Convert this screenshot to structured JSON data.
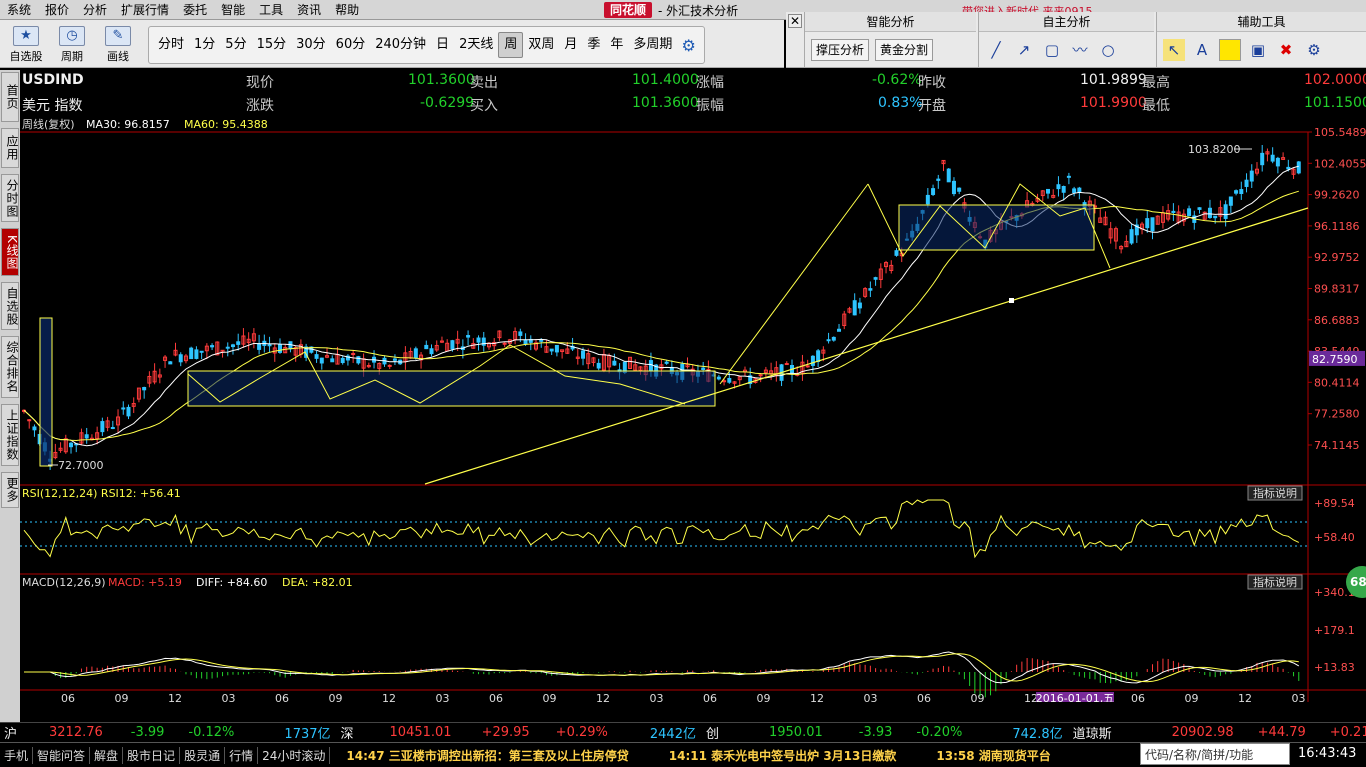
{
  "menu": {
    "items": [
      "系统",
      "报价",
      "分析",
      "扩展行情",
      "委托",
      "智能",
      "工具",
      "资讯",
      "帮助"
    ],
    "brand": "同花顺",
    "app_title": "- 外汇技术分析",
    "news": "带您进入新时代  来来0915"
  },
  "toolbar": {
    "favorites_label": "自选股",
    "cycle_label": "周期",
    "draw_label": "画线",
    "periods": [
      "分时",
      "1分",
      "5分",
      "15分",
      "30分",
      "60分",
      "240分钟",
      "日",
      "2天线",
      "周",
      "双周",
      "月",
      "季",
      "年",
      "多周期"
    ],
    "active_period": "周"
  },
  "right_tools": {
    "smart_title": "智能分析",
    "smart_buttons": [
      "撑压分析",
      "黄金分割"
    ],
    "self_title": "自主分析",
    "aux_title": "辅助工具"
  },
  "left_tabs": [
    "首页",
    "应用",
    "分时图",
    "K线图",
    "自选股",
    "综合排名",
    "上证指数",
    "更多"
  ],
  "quote": {
    "symbol": "USDIND",
    "name": "美元 指数",
    "price_label": "现价",
    "price": "101.3600",
    "change_label": "涨跌",
    "change": "-0.6299",
    "sell_label": "卖出",
    "sell": "101.4000",
    "buy_label": "买入",
    "buy": "101.3600",
    "pct_label": "涨幅",
    "pct": "-0.62%",
    "amp_label": "振幅",
    "amp": "0.83%",
    "prev_label": "昨收",
    "prev": "101.9899",
    "open_label": "开盘",
    "open": "101.9900",
    "high_label": "最高",
    "high": "102.0000",
    "low_label": "最低",
    "low": "101.1500"
  },
  "chart_data": {
    "type": "line",
    "main_header": {
      "period": "周线(复权)",
      "ma30": "MA30: 96.8157",
      "ma60": "MA60: 95.4388"
    },
    "price_axis": [
      "105.5489",
      "102.4055",
      "99.2620",
      "96.1186",
      "92.9752",
      "89.8317",
      "86.6883",
      "83.5449",
      "80.4114",
      "77.2580",
      "74.1145"
    ],
    "current_price_tag": "82.7590",
    "annotations": [
      "103.8200",
      "72.7000"
    ],
    "rsi_header": "RSI(12,12,24)  RSI12: +56.41",
    "rsi_axis": [
      "+89.54",
      "+58.40"
    ],
    "macd_header": {
      "name": "MACD(12,26,9)",
      "macd": "MACD: +5.19",
      "diff": "DIFF: +84.60",
      "dea": "DEA: +82.01"
    },
    "macd_axis": [
      "+340.1",
      "+179.1",
      "+13.83"
    ],
    "indicator_button": "指标说明",
    "x_ticks": [
      "06",
      "09",
      "12",
      "03",
      "06",
      "09",
      "12",
      "03",
      "06",
      "09",
      "12",
      "03",
      "06",
      "09",
      "12",
      "03",
      "06",
      "09",
      "12",
      "03",
      "06",
      "09",
      "12",
      "03"
    ],
    "cursor_date": "2016-01-01,五"
  },
  "colors": {
    "up": "#ff3b3b",
    "down": "#22d02b",
    "ma_white": "#ffffff",
    "ma_yellow": "#ffff4a",
    "box_fill": "#0a2a6a"
  },
  "ticker": [
    {
      "t": "沪",
      "c": "wh"
    },
    {
      "t": "3212.76",
      "c": "up"
    },
    {
      "t": "-3.99",
      "c": "dn"
    },
    {
      "t": "-0.12%",
      "c": "dn"
    },
    {
      "t": "1737亿",
      "c": "cy"
    },
    {
      "t": "深",
      "c": "wh"
    },
    {
      "t": "10451.01",
      "c": "up"
    },
    {
      "t": "+29.95",
      "c": "up"
    },
    {
      "t": "+0.29%",
      "c": "up"
    },
    {
      "t": "2442亿",
      "c": "cy"
    },
    {
      "t": "创",
      "c": "wh"
    },
    {
      "t": "1950.01",
      "c": "dn"
    },
    {
      "t": "-3.93",
      "c": "dn"
    },
    {
      "t": "-0.20%",
      "c": "dn"
    },
    {
      "t": "742.8亿",
      "c": "cy"
    },
    {
      "t": "道琼斯",
      "c": "wh"
    },
    {
      "t": "20902.98",
      "c": "up"
    },
    {
      "t": "+44.79",
      "c": "up"
    },
    {
      "t": "+0.21%",
      "c": "up"
    }
  ],
  "statusbar": {
    "items": [
      "手机",
      "智能问答",
      "解盘",
      "股市日记",
      "股灵通",
      "行情",
      "24小时滚动"
    ],
    "news": [
      "14:47 三亚楼市调控出新招：第三套及以上住房停贷",
      "14:11 泰禾光电中签号出炉 3月13日缴款",
      "13:58 湖南现货平台"
    ],
    "search_placeholder": "代码/名称/简拼/功能",
    "clock": "16:43:43"
  },
  "badge": "68"
}
